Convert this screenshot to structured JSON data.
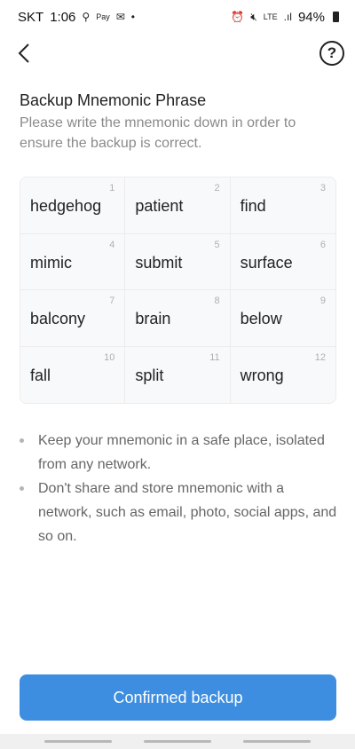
{
  "status_bar": {
    "carrier": "SKT",
    "time": "1:06",
    "left_icons": [
      "bell-icon",
      "pay-icon",
      "mail-icon",
      "dot-icon"
    ],
    "left_icon_glyphs": [
      "⚲",
      "Pay",
      "✉",
      "•"
    ],
    "network": "LTE",
    "signal": ".ıl",
    "battery_percent": "94%"
  },
  "nav": {
    "back_icon": "chevron-left-icon",
    "help_label": "?"
  },
  "page": {
    "title": "Backup Mnemonic Phrase",
    "subtitle": "Please write the mnemonic down in order to ensure the backup is correct."
  },
  "words": [
    {
      "num": "1",
      "word": "hedgehog"
    },
    {
      "num": "2",
      "word": "patient"
    },
    {
      "num": "3",
      "word": "find"
    },
    {
      "num": "4",
      "word": "mimic"
    },
    {
      "num": "5",
      "word": "submit"
    },
    {
      "num": "6",
      "word": "surface"
    },
    {
      "num": "7",
      "word": "balcony"
    },
    {
      "num": "8",
      "word": "brain"
    },
    {
      "num": "9",
      "word": "below"
    },
    {
      "num": "10",
      "word": "fall"
    },
    {
      "num": "11",
      "word": "split"
    },
    {
      "num": "12",
      "word": "wrong"
    }
  ],
  "notes": [
    "Keep your mnemonic in a safe place, isolated from any network.",
    "Don't share and store mnemonic with a network, such as email, photo, social apps, and so on."
  ],
  "confirm_button": {
    "label": "Confirmed backup",
    "color": "#3d8ee0"
  }
}
